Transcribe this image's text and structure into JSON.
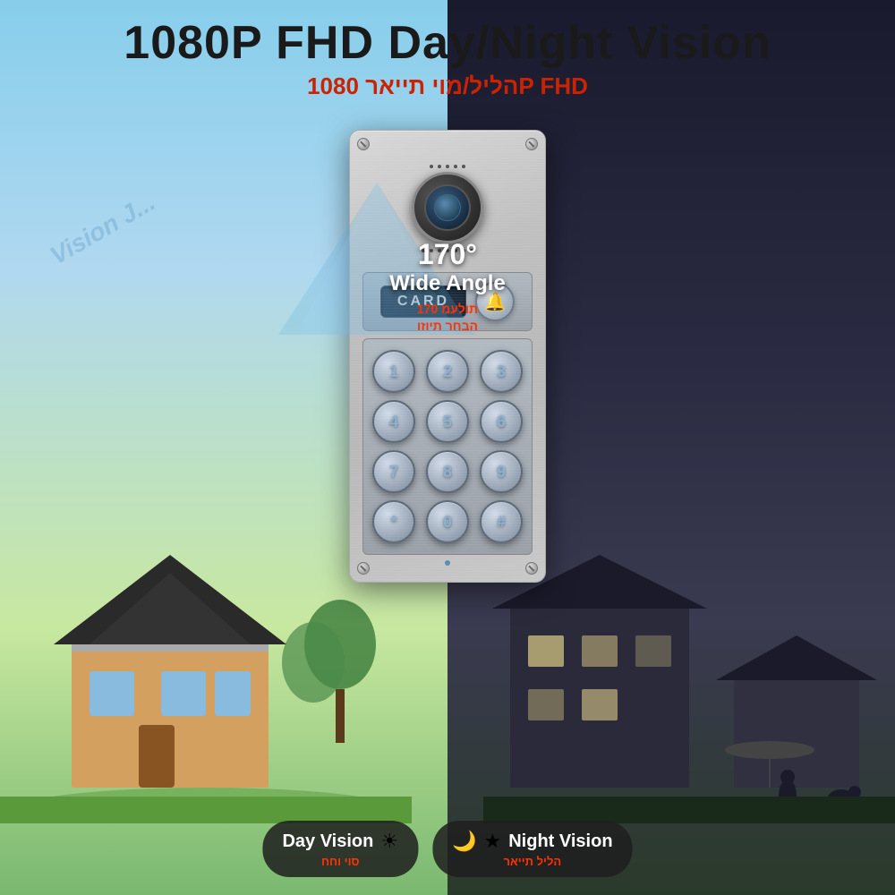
{
  "header": {
    "main_title": "1080P FHD Day/Night Vision",
    "subtitle_hebrew": "הליל/מוי תייאר 1080P FHD"
  },
  "camera": {
    "angle_degrees": "170°",
    "angle_label": "Wide Angle",
    "angle_hebrew_line1": "תולעמ 170",
    "angle_hebrew_line2": "הבחר תיוזו"
  },
  "card_reader": {
    "label": "CARD"
  },
  "keypad": {
    "keys": [
      "1",
      "2",
      "3",
      "4",
      "5",
      "6",
      "7",
      "8",
      "9",
      "*",
      "0",
      "#"
    ]
  },
  "badges": {
    "day": {
      "label": "Day Vision",
      "icon": "☀",
      "hebrew": "סוי וחח"
    },
    "night": {
      "label": "Night Vision",
      "icon": "🌙",
      "hebrew": "הליל תייאר"
    }
  },
  "watermark": "Vision J..."
}
